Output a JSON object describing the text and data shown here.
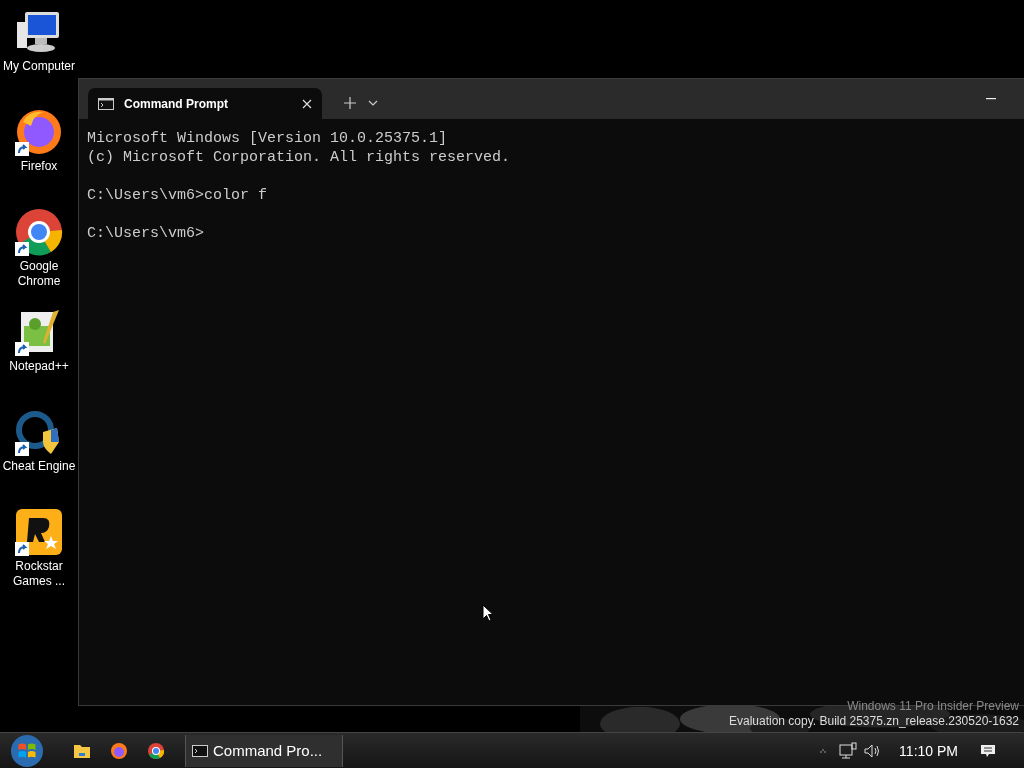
{
  "desktop_icons": [
    {
      "label": "My Computer",
      "kind": "computer",
      "shortcut": false
    },
    {
      "label": "Firefox",
      "kind": "firefox",
      "shortcut": true
    },
    {
      "label": "Google Chrome",
      "kind": "chrome",
      "shortcut": true
    },
    {
      "label": "Notepad++",
      "kind": "notepad",
      "shortcut": true
    },
    {
      "label": "Cheat Engine",
      "kind": "cheat-engine",
      "shortcut": true
    },
    {
      "label": "Rockstar Games ...",
      "kind": "rockstar",
      "shortcut": true
    }
  ],
  "terminal": {
    "tabs": [
      {
        "title": "Command Prompt",
        "selected": true
      }
    ],
    "blocks": [
      [
        "Microsoft Windows [Version 10.0.25375.1]",
        "(c) Microsoft Corporation. All rights reserved."
      ],
      [
        "C:\\Users\\vm6>color f"
      ],
      [
        "C:\\Users\\vm6>"
      ]
    ]
  },
  "watermark": [
    "Windows 11 Pro Insider Preview",
    "Evaluation copy. Build 25375.zn_release.230520-1632"
  ],
  "taskbar": {
    "pinned": [
      {
        "kind": "folder"
      },
      {
        "kind": "firefox"
      },
      {
        "kind": "chrome"
      }
    ],
    "tasks": [
      {
        "label": "Command Pro...",
        "selected": true
      }
    ],
    "clock": "11:10 PM"
  }
}
